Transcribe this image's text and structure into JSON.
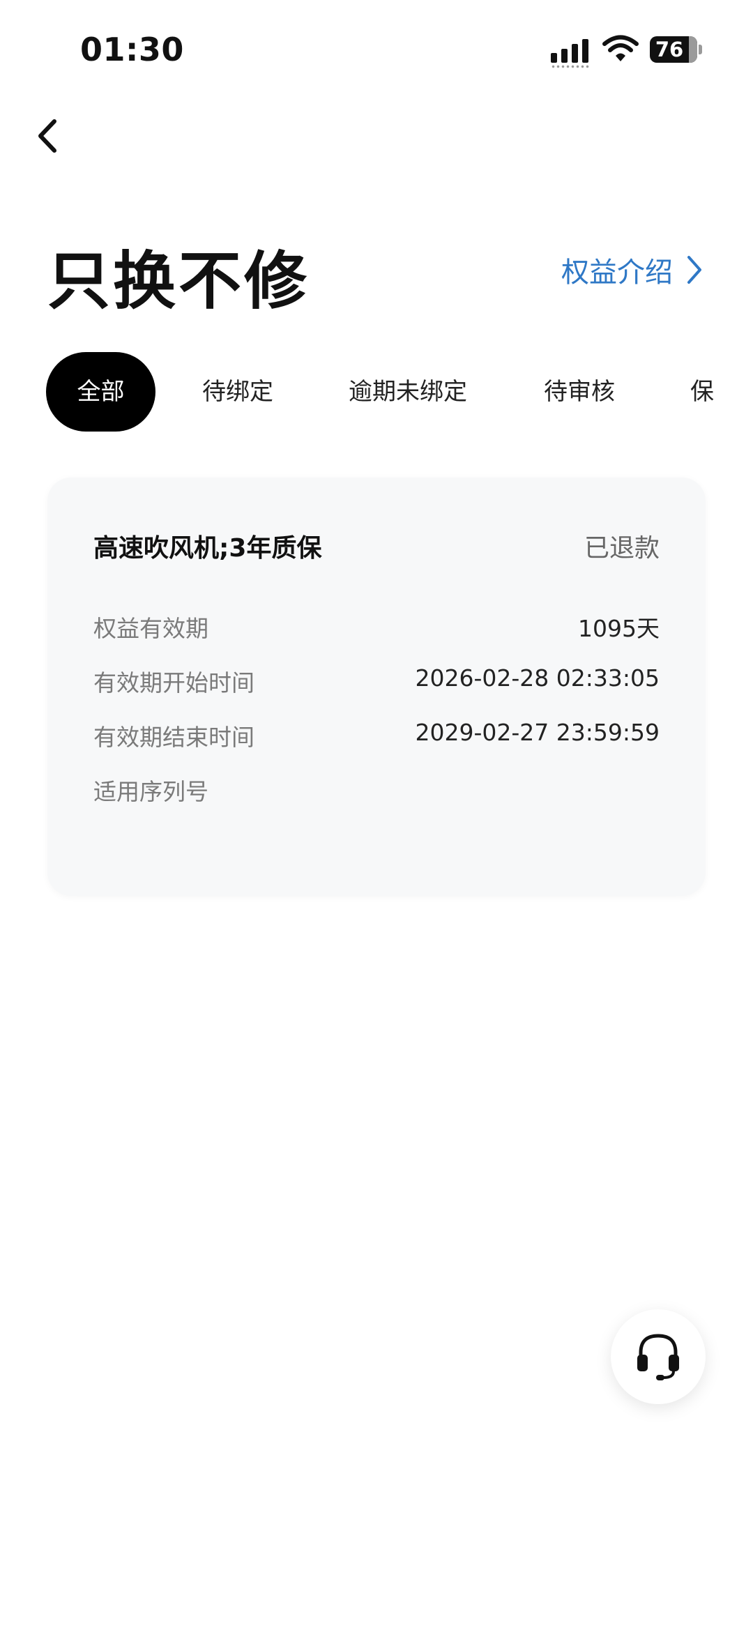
{
  "status_bar": {
    "time": "01:30",
    "battery": "76"
  },
  "header": {
    "title": "只换不修",
    "benefit_link": "权益介绍"
  },
  "tabs": [
    {
      "label": "全部",
      "active": true
    },
    {
      "label": "待绑定",
      "active": false
    },
    {
      "label": "逾期未绑定",
      "active": false
    },
    {
      "label": "待审核",
      "active": false
    },
    {
      "label": "保",
      "active": false
    }
  ],
  "card": {
    "title": "高速吹风机;3年质保",
    "status": "已退款",
    "rows": [
      {
        "label": "权益有效期",
        "value": "1095天"
      },
      {
        "label": "有效期开始时间",
        "value": "2026-02-28 02:33:05"
      },
      {
        "label": "有效期结束时间",
        "value": "2029-02-27 23:59:59"
      },
      {
        "label": "适用序列号",
        "value": ""
      }
    ]
  },
  "colors": {
    "accent_link": "#2f78c6",
    "active_tab_bg": "#000000",
    "card_bg": "#f7f8f9"
  },
  "icons": {
    "back": "chevron-left-icon",
    "link_arrow": "chevron-right-icon",
    "service": "headset-icon"
  }
}
